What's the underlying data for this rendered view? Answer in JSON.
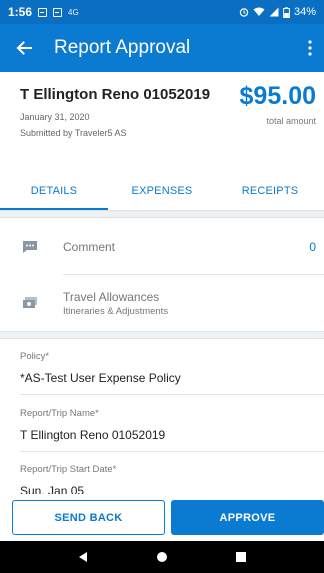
{
  "status_bar": {
    "time": "1:56",
    "network": "4G",
    "battery": "34%"
  },
  "app_bar": {
    "title": "Report Approval",
    "back_icon": "arrow-left-icon",
    "menu_icon": "more-vert-icon"
  },
  "report": {
    "name": "T Ellington Reno 01052019",
    "date": "January 31, 2020",
    "submitted_by": "Submitted by Traveler5 AS",
    "total_amount": "$95.00",
    "total_label": "total amount"
  },
  "tabs": [
    {
      "label": "DETAILS",
      "active": true
    },
    {
      "label": "EXPENSES",
      "active": false
    },
    {
      "label": "RECEIPTS",
      "active": false
    }
  ],
  "rows": {
    "comment": {
      "label": "Comment",
      "count": "0",
      "icon": "comment-icon"
    },
    "travel": {
      "label": "Travel Allowances",
      "sublabel": "Itineraries & Adjustments",
      "icon": "money-icon"
    }
  },
  "fields": [
    {
      "label": "Policy*",
      "value": "*AS-Test User Expense Policy"
    },
    {
      "label": "Report/Trip Name*",
      "value": "T Ellington Reno 01052019"
    },
    {
      "label": "Report/Trip Start Date*",
      "value": "Sun, Jan 05"
    }
  ],
  "actions": {
    "send_back": "SEND BACK",
    "approve": "APPROVE"
  },
  "colors": {
    "primary": "#0b7ad1",
    "status_bar": "#0a6fc2"
  }
}
